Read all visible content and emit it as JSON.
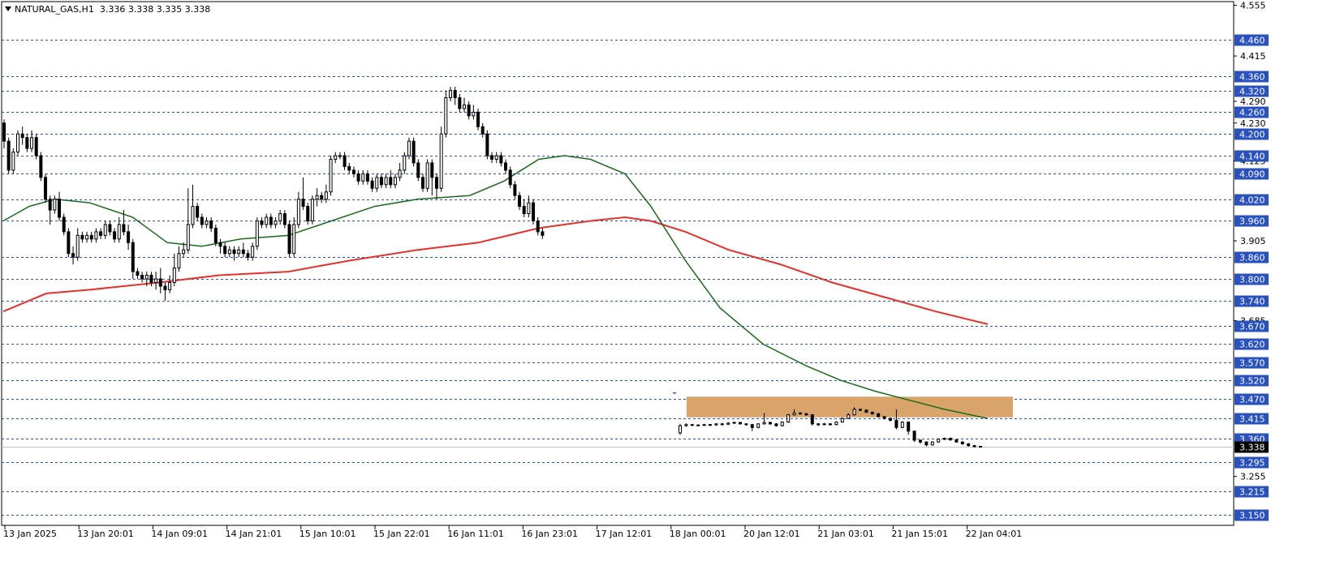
{
  "header": {
    "symbol_timeframe": "NATURAL_GAS,H1",
    "ohlc": "3.336 3.338 3.335 3.338"
  },
  "colors": {
    "background": "#ffffff",
    "level_line": "#2a52be",
    "level_label_bg": "#2a52be",
    "level_label_text": "#ffffff",
    "ma_fast": "#1a6b1a",
    "ma_slow": "#e8302a",
    "zone_fill": "#d9a46a",
    "current_price_bg": "#000000",
    "candle_outline": "#000000"
  },
  "chart_data": {
    "type": "candlestick",
    "symbol": "NATURAL_GAS",
    "timeframe": "H1",
    "price_axis": {
      "range": [
        3.12,
        4.565
      ],
      "ticks": [
        "4.555",
        "4.415",
        "4.290",
        "4.230",
        "4.125",
        "3.905",
        "3.685",
        "3.255"
      ]
    },
    "time_axis": {
      "labels": [
        "13 Jan 2025",
        "13 Jan 20:01",
        "14 Jan 09:01",
        "14 Jan 21:01",
        "15 Jan 10:01",
        "15 Jan 22:01",
        "16 Jan 11:01",
        "16 Jan 23:01",
        "17 Jan 12:01",
        "18 Jan 00:01",
        "20 Jan 12:01",
        "21 Jan 03:01",
        "21 Jan 15:01",
        "22 Jan 04:01"
      ]
    },
    "horizontal_levels": [
      "4.460",
      "4.360",
      "4.320",
      "4.260",
      "4.200",
      "4.140",
      "4.090",
      "4.020",
      "3.960",
      "3.860",
      "3.800",
      "3.740",
      "3.670",
      "3.620",
      "3.570",
      "3.520",
      "3.470",
      "3.415",
      "3.360",
      "3.295",
      "3.215",
      "3.150"
    ],
    "current_price": "3.338",
    "zone": {
      "price_low": 3.418,
      "price_high": 3.475,
      "from": "18 Jan 00:01",
      "to": "22 Jan 04:01"
    },
    "candles_part1": [
      [
        4.23,
        4.18,
        4.24,
        4.16
      ],
      [
        4.18,
        4.1,
        4.19,
        4.09
      ],
      [
        4.1,
        4.15,
        4.16,
        4.09
      ],
      [
        4.15,
        4.2,
        4.21,
        4.14
      ],
      [
        4.2,
        4.19,
        4.22,
        4.17
      ],
      [
        4.19,
        4.16,
        4.2,
        4.15
      ],
      [
        4.16,
        4.19,
        4.21,
        4.15
      ],
      [
        4.19,
        4.14,
        4.2,
        4.13
      ],
      [
        4.14,
        4.08,
        4.15,
        4.07
      ],
      [
        4.08,
        4.02,
        4.09,
        4.01
      ],
      [
        4.02,
        3.99,
        4.03,
        3.95
      ],
      [
        3.99,
        4.02,
        4.03,
        3.98
      ],
      [
        4.02,
        3.97,
        4.04,
        3.96
      ],
      [
        3.97,
        3.93,
        3.98,
        3.92
      ],
      [
        3.93,
        3.87,
        3.94,
        3.86
      ],
      [
        3.87,
        3.86,
        3.89,
        3.84
      ],
      [
        3.86,
        3.92,
        3.94,
        3.85
      ],
      [
        3.92,
        3.91,
        3.93,
        3.9
      ],
      [
        3.91,
        3.92,
        3.93,
        3.9
      ],
      [
        3.92,
        3.91,
        3.93,
        3.9
      ],
      [
        3.91,
        3.93,
        3.94,
        3.9
      ],
      [
        3.93,
        3.92,
        3.94,
        3.91
      ],
      [
        3.92,
        3.95,
        3.96,
        3.91
      ],
      [
        3.95,
        3.93,
        3.96,
        3.92
      ],
      [
        3.93,
        3.91,
        3.94,
        3.9
      ],
      [
        3.91,
        3.95,
        3.97,
        3.9
      ],
      [
        3.95,
        3.93,
        3.99,
        3.92
      ],
      [
        3.93,
        3.9,
        3.95,
        3.88
      ],
      [
        3.9,
        3.82,
        3.91,
        3.8
      ],
      [
        3.82,
        3.81,
        3.83,
        3.8
      ],
      [
        3.81,
        3.8,
        3.82,
        3.79
      ],
      [
        3.8,
        3.81,
        3.82,
        3.78
      ],
      [
        3.81,
        3.79,
        3.82,
        3.78
      ],
      [
        3.79,
        3.8,
        3.82,
        3.77
      ],
      [
        3.8,
        3.78,
        3.83,
        3.76
      ],
      [
        3.78,
        3.77,
        3.79,
        3.74
      ],
      [
        3.77,
        3.79,
        3.81,
        3.76
      ],
      [
        3.79,
        3.83,
        3.87,
        3.78
      ],
      [
        3.83,
        3.87,
        3.89,
        3.82
      ],
      [
        3.87,
        3.88,
        3.9,
        3.86
      ],
      [
        3.88,
        3.95,
        4.05,
        3.87
      ],
      [
        3.95,
        4.0,
        4.06,
        3.94
      ],
      [
        4.0,
        3.97,
        4.01,
        3.96
      ],
      [
        3.97,
        3.95,
        3.98,
        3.94
      ],
      [
        3.95,
        3.96,
        3.97,
        3.94
      ],
      [
        3.96,
        3.94,
        3.97,
        3.93
      ],
      [
        3.94,
        3.9,
        3.95,
        3.89
      ],
      [
        3.9,
        3.89,
        3.91,
        3.87
      ],
      [
        3.89,
        3.87,
        3.9,
        3.86
      ],
      [
        3.87,
        3.88,
        3.89,
        3.86
      ],
      [
        3.88,
        3.87,
        3.89,
        3.85
      ],
      [
        3.87,
        3.88,
        3.89,
        3.86
      ],
      [
        3.88,
        3.87,
        3.9,
        3.86
      ],
      [
        3.87,
        3.86,
        3.88,
        3.85
      ],
      [
        3.86,
        3.89,
        3.9,
        3.85
      ],
      [
        3.89,
        3.96,
        3.97,
        3.88
      ],
      [
        3.96,
        3.95,
        3.97,
        3.94
      ],
      [
        3.95,
        3.97,
        3.98,
        3.94
      ]
    ],
    "candles_part2": [
      [
        3.97,
        3.95,
        3.98,
        3.94
      ],
      [
        3.95,
        3.96,
        3.97,
        3.94
      ],
      [
        3.96,
        3.98,
        3.99,
        3.95
      ],
      [
        3.98,
        3.95,
        3.99,
        3.94
      ],
      [
        3.95,
        3.87,
        3.96,
        3.86
      ],
      [
        3.87,
        3.95,
        3.97,
        3.86
      ],
      [
        3.95,
        4.02,
        4.04,
        3.94
      ],
      [
        4.02,
        4.0,
        4.08,
        3.99
      ],
      [
        4.0,
        3.96,
        4.01,
        3.95
      ],
      [
        3.96,
        4.02,
        4.03,
        3.95
      ],
      [
        4.02,
        4.03,
        4.05,
        4.0
      ],
      [
        4.03,
        4.02,
        4.04,
        4.01
      ],
      [
        4.02,
        4.04,
        4.06,
        4.01
      ],
      [
        4.04,
        4.13,
        4.14,
        4.03
      ],
      [
        4.13,
        4.14,
        4.15,
        4.12
      ],
      [
        4.14,
        4.14,
        4.15,
        4.13
      ],
      [
        4.14,
        4.11,
        4.15,
        4.1
      ],
      [
        4.11,
        4.1,
        4.12,
        4.09
      ],
      [
        4.1,
        4.09,
        4.11,
        4.08
      ],
      [
        4.09,
        4.07,
        4.1,
        4.06
      ],
      [
        4.07,
        4.09,
        4.1,
        4.06
      ],
      [
        4.09,
        4.07,
        4.1,
        4.06
      ],
      [
        4.07,
        4.05,
        4.08,
        4.04
      ],
      [
        4.05,
        4.08,
        4.09,
        4.04
      ],
      [
        4.08,
        4.06,
        4.09,
        4.05
      ],
      [
        4.06,
        4.08,
        4.09,
        4.05
      ],
      [
        4.08,
        4.06,
        4.1,
        4.05
      ],
      [
        4.06,
        4.08,
        4.09,
        4.05
      ],
      [
        4.08,
        4.1,
        4.12,
        4.07
      ],
      [
        4.1,
        4.14,
        4.15,
        4.09
      ],
      [
        4.14,
        4.18,
        4.19,
        4.13
      ],
      [
        4.18,
        4.12,
        4.19,
        4.11
      ],
      [
        4.12,
        4.08,
        4.13,
        4.07
      ],
      [
        4.08,
        4.05,
        4.09,
        4.04
      ],
      [
        4.05,
        4.12,
        4.13,
        4.04
      ],
      [
        4.12,
        4.08,
        4.13,
        4.03
      ],
      [
        4.08,
        4.05,
        4.09,
        4.02
      ],
      [
        4.05,
        4.2,
        4.22,
        4.04
      ],
      [
        4.2,
        4.3,
        4.32,
        4.19
      ],
      [
        4.3,
        4.32,
        4.33,
        4.29
      ],
      [
        4.32,
        4.3,
        4.33,
        4.28
      ],
      [
        4.3,
        4.27,
        4.31,
        4.26
      ],
      [
        4.27,
        4.28,
        4.3,
        4.26
      ],
      [
        4.28,
        4.25,
        4.29,
        4.24
      ],
      [
        4.25,
        4.26,
        4.28,
        4.24
      ],
      [
        4.26,
        4.22,
        4.27,
        4.21
      ],
      [
        4.22,
        4.2,
        4.23,
        4.19
      ],
      [
        4.2,
        4.14,
        4.21,
        4.13
      ],
      [
        4.14,
        4.13,
        4.15,
        4.12
      ],
      [
        4.13,
        4.14,
        4.15,
        4.12
      ],
      [
        4.14,
        4.12,
        4.15,
        4.11
      ],
      [
        4.12,
        4.1,
        4.13,
        4.09
      ],
      [
        4.1,
        4.06,
        4.11,
        4.05
      ],
      [
        4.06,
        4.03,
        4.07,
        4.02
      ],
      [
        4.03,
        4.0,
        4.04,
        3.99
      ],
      [
        4.0,
        3.98,
        4.02,
        3.97
      ],
      [
        3.98,
        4.01,
        4.03,
        3.97
      ],
      [
        4.01,
        3.96,
        4.02,
        3.95
      ],
      [
        3.96,
        3.93,
        3.97,
        3.92
      ],
      [
        3.93,
        3.92,
        3.94,
        3.91
      ]
    ],
    "candles_part3": [
      [
        3.375,
        3.395,
        3.4,
        3.37
      ],
      [
        3.395,
        3.398,
        3.402,
        3.392
      ],
      [
        3.398,
        3.397,
        3.4,
        3.394
      ],
      [
        3.397,
        3.396,
        3.399,
        3.393
      ],
      [
        3.396,
        3.398,
        3.4,
        3.394
      ],
      [
        3.398,
        3.397,
        3.4,
        3.395
      ],
      [
        3.397,
        3.4,
        3.402,
        3.395
      ],
      [
        3.4,
        3.399,
        3.403,
        3.396
      ],
      [
        3.399,
        3.402,
        3.405,
        3.397
      ],
      [
        3.402,
        3.404,
        3.406,
        3.4
      ],
      [
        3.404,
        3.4,
        3.405,
        3.398
      ],
      [
        3.4,
        3.398,
        3.402,
        3.395
      ],
      [
        3.398,
        3.39,
        3.4,
        3.38
      ],
      [
        3.39,
        3.4,
        3.402,
        3.388
      ],
      [
        3.4,
        3.404,
        3.43,
        3.398
      ],
      [
        3.404,
        3.4,
        3.406,
        3.397
      ],
      [
        3.4,
        3.395,
        3.402,
        3.392
      ],
      [
        3.395,
        3.405,
        3.407,
        3.393
      ],
      [
        3.405,
        3.425,
        3.427,
        3.403
      ],
      [
        3.425,
        3.43,
        3.44,
        3.423
      ],
      [
        3.43,
        3.428,
        3.432,
        3.425
      ],
      [
        3.428,
        3.425,
        3.43,
        3.422
      ],
      [
        3.425,
        3.4,
        3.427,
        3.395
      ],
      [
        3.4,
        3.398,
        3.402,
        3.394
      ],
      [
        3.398,
        3.4,
        3.403,
        3.396
      ],
      [
        3.4,
        3.398,
        3.402,
        3.395
      ],
      [
        3.398,
        3.405,
        3.407,
        3.396
      ],
      [
        3.405,
        3.415,
        3.418,
        3.403
      ],
      [
        3.415,
        3.425,
        3.43,
        3.413
      ],
      [
        3.425,
        3.44,
        3.446,
        3.423
      ],
      [
        3.44,
        3.438,
        3.442,
        3.435
      ],
      [
        3.438,
        3.432,
        3.44,
        3.43
      ],
      [
        3.432,
        3.428,
        3.434,
        3.425
      ],
      [
        3.428,
        3.42,
        3.43,
        3.418
      ],
      [
        3.42,
        3.415,
        3.422,
        3.412
      ],
      [
        3.415,
        3.41,
        3.417,
        3.407
      ],
      [
        3.41,
        3.39,
        3.44,
        3.385
      ],
      [
        3.39,
        3.405,
        3.407,
        3.388
      ],
      [
        3.405,
        3.38,
        3.407,
        3.37
      ],
      [
        3.38,
        3.355,
        3.382,
        3.35
      ],
      [
        3.355,
        3.35,
        3.357,
        3.345
      ],
      [
        3.35,
        3.342,
        3.352,
        3.338
      ],
      [
        3.342,
        3.35,
        3.352,
        3.34
      ],
      [
        3.35,
        3.358,
        3.36,
        3.348
      ],
      [
        3.358,
        3.36,
        3.362,
        3.355
      ],
      [
        3.36,
        3.356,
        3.362,
        3.353
      ],
      [
        3.356,
        3.35,
        3.358,
        3.348
      ],
      [
        3.35,
        3.345,
        3.352,
        3.342
      ],
      [
        3.345,
        3.34,
        3.347,
        3.337
      ],
      [
        3.34,
        3.337,
        3.342,
        3.335
      ],
      [
        3.337,
        3.338,
        3.339,
        3.335
      ]
    ],
    "ma_fast": {
      "name": "",
      "points": [
        [
          0,
          3.96
        ],
        [
          6,
          4.0
        ],
        [
          12,
          4.02
        ],
        [
          20,
          4.01
        ],
        [
          30,
          3.97
        ],
        [
          38,
          3.9
        ],
        [
          46,
          3.89
        ],
        [
          55,
          3.91
        ],
        [
          66,
          3.92
        ],
        [
          76,
          3.96
        ],
        [
          86,
          4.0
        ],
        [
          96,
          4.02
        ],
        [
          108,
          4.03
        ],
        [
          116,
          4.07
        ],
        [
          124,
          4.13
        ],
        [
          130,
          4.14
        ],
        [
          136,
          4.13
        ],
        [
          144,
          4.09
        ],
        [
          150,
          4.0
        ],
        [
          158,
          3.85
        ],
        [
          166,
          3.72
        ],
        [
          176,
          3.62
        ],
        [
          186,
          3.56
        ],
        [
          194,
          3.52
        ],
        [
          202,
          3.49
        ],
        [
          210,
          3.465
        ],
        [
          218,
          3.44
        ],
        [
          228,
          3.415
        ]
      ]
    },
    "ma_slow": {
      "name": "",
      "points": [
        [
          0,
          3.71
        ],
        [
          10,
          3.76
        ],
        [
          20,
          3.77
        ],
        [
          36,
          3.79
        ],
        [
          50,
          3.81
        ],
        [
          66,
          3.82
        ],
        [
          80,
          3.85
        ],
        [
          96,
          3.88
        ],
        [
          110,
          3.9
        ],
        [
          124,
          3.94
        ],
        [
          136,
          3.96
        ],
        [
          144,
          3.97
        ],
        [
          150,
          3.96
        ],
        [
          158,
          3.93
        ],
        [
          168,
          3.88
        ],
        [
          180,
          3.84
        ],
        [
          192,
          3.79
        ],
        [
          204,
          3.75
        ],
        [
          216,
          3.71
        ],
        [
          228,
          3.675
        ]
      ]
    },
    "stray_tick_price": 3.485
  }
}
